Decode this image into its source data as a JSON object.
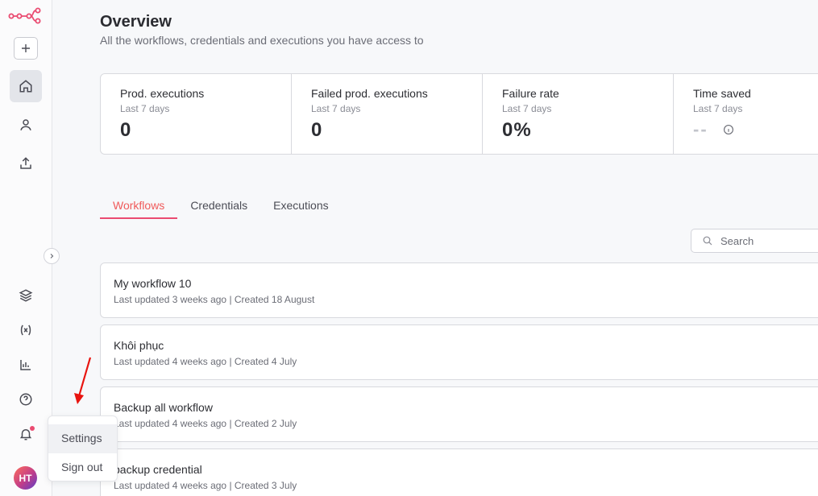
{
  "sidebar": {
    "logo": "n8n-logo-icon",
    "items": [
      {
        "name": "add",
        "icon": "plus-icon"
      },
      {
        "name": "overview",
        "icon": "home-icon",
        "active": true
      },
      {
        "name": "personal",
        "icon": "user-icon"
      },
      {
        "name": "shared",
        "icon": "share-icon"
      },
      {
        "name": "templates",
        "icon": "box-icon"
      },
      {
        "name": "variables",
        "icon": "variables-icon"
      },
      {
        "name": "insights",
        "icon": "chart-icon"
      },
      {
        "name": "help",
        "icon": "help-icon"
      },
      {
        "name": "notifications",
        "icon": "bell-icon",
        "badge": true
      }
    ],
    "avatar_initials": "HT"
  },
  "header": {
    "title": "Overview",
    "subtitle": "All the workflows, credentials and executions you have access to"
  },
  "stats": [
    {
      "title": "Prod. executions",
      "period": "Last 7 days",
      "value": "0"
    },
    {
      "title": "Failed prod. executions",
      "period": "Last 7 days",
      "value": "0"
    },
    {
      "title": "Failure rate",
      "period": "Last 7 days",
      "value": "0%"
    },
    {
      "title": "Time saved",
      "period": "Last 7 days",
      "value": "--"
    }
  ],
  "tabs": [
    {
      "label": "Workflows",
      "active": true
    },
    {
      "label": "Credentials"
    },
    {
      "label": "Executions"
    }
  ],
  "search": {
    "placeholder": "Search",
    "value": ""
  },
  "workflows": [
    {
      "name": "My workflow 10",
      "meta": "Last updated 3 weeks ago | Created 18 August"
    },
    {
      "name": "Khôi phục",
      "meta": "Last updated 4 weeks ago | Created 4 July"
    },
    {
      "name": "Backup all workflow",
      "meta": "Last updated 4 weeks ago | Created 2 July"
    },
    {
      "name": "backup credential",
      "meta": "Last updated 4 weeks ago | Created 3 July"
    }
  ],
  "user_menu": {
    "items": [
      {
        "label": "Settings",
        "hover": true
      },
      {
        "label": "Sign out"
      }
    ]
  },
  "colors": {
    "accent": "#ea4b71",
    "tab_active": "#f05a5a",
    "arrow": "#e8140f"
  }
}
